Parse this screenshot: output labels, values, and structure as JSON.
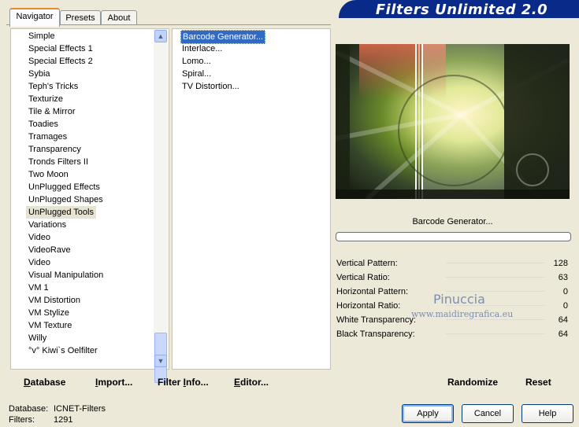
{
  "tabs": [
    "Navigator",
    "Presets",
    "About"
  ],
  "title": "Filters Unlimited 2.0",
  "categories": [
    "Simple",
    "Special Effects 1",
    "Special Effects 2",
    "Sybia",
    "Teph's Tricks",
    "Texturize",
    "Tile & Mirror",
    "Toadies",
    "Tramages",
    "Transparency",
    "Tronds Filters II",
    "Two Moon",
    "UnPlugged Effects",
    "UnPlugged Shapes",
    "UnPlugged Tools",
    "Variations",
    "Video",
    "VideoRave",
    "Video",
    "Visual Manipulation",
    "VM 1",
    "VM Distortion",
    "VM Stylize",
    "VM Texture",
    "Willy",
    "°v° Kiwi`s Oelfilter"
  ],
  "selected_category": "UnPlugged Tools",
  "filters": [
    "Barcode Generator...",
    "Interlace...",
    "Lomo...",
    "Spiral...",
    "TV Distortion..."
  ],
  "selected_filter": "Barcode Generator...",
  "filter_title": "Barcode Generator...",
  "params": [
    {
      "label": "Vertical Pattern:",
      "value": "128"
    },
    {
      "label": "Vertical Ratio:",
      "value": "63"
    },
    {
      "label": "Horizontal Pattern:",
      "value": "0"
    },
    {
      "label": "Horizontal Ratio:",
      "value": "0"
    },
    {
      "label": "White Transparency:",
      "value": "64"
    },
    {
      "label": "Black Transparency:",
      "value": "64"
    }
  ],
  "watermark": {
    "line1": "Pinuccia",
    "line2": "www.maidiregrafica.eu"
  },
  "bottom_links": {
    "database": {
      "u": "D",
      "rest": "atabase"
    },
    "import": {
      "u": "I",
      "rest": "mport..."
    },
    "filter_info": {
      "pre": "Filter ",
      "u": "I",
      "rest": "nfo..."
    },
    "editor": {
      "u": "E",
      "rest": "ditor..."
    },
    "randomize": "Randomize",
    "reset": "Reset"
  },
  "buttons": {
    "apply": "Apply",
    "cancel": "Cancel",
    "help": "Help"
  },
  "status": {
    "database_label": "Database:",
    "database_value": "ICNET-Filters",
    "filters_label": "Filters:",
    "filters_value": "1291"
  }
}
